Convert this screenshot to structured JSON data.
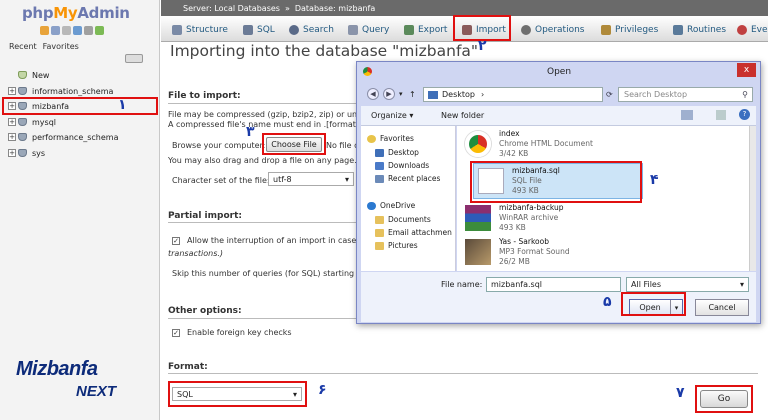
{
  "sidebar": {
    "logo_php": "php",
    "logo_my": "My",
    "logo_admin": "Admin",
    "recent_tab": "Recent",
    "favorites_tab": "Favorites",
    "tree": [
      {
        "label": "New",
        "expander": ""
      },
      {
        "label": "information_schema",
        "expander": "+"
      },
      {
        "label": "mizbanfa",
        "expander": "+"
      },
      {
        "label": "mysql",
        "expander": "+"
      },
      {
        "label": "performance_schema",
        "expander": "+"
      },
      {
        "label": "sys",
        "expander": "+"
      }
    ],
    "brand": "Mizbanfa",
    "brand_sub": "NEXT"
  },
  "breadcrumb": {
    "server": "Server: Local Databases",
    "separator": "»",
    "database": "Database: mizbanfa"
  },
  "tabs": [
    {
      "label": "Structure",
      "icon": "structure-icon",
      "color": "#7a8aa6"
    },
    {
      "label": "SQL",
      "icon": "sql-icon",
      "color": "#6b7b96"
    },
    {
      "label": "Search",
      "icon": "search-icon",
      "color": "#5a6a88"
    },
    {
      "label": "Query",
      "icon": "query-icon",
      "color": "#8a94aa"
    },
    {
      "label": "Export",
      "icon": "export-icon",
      "color": "#5b8a5b"
    },
    {
      "label": "Import",
      "icon": "import-icon",
      "color": "#8a5b5b"
    },
    {
      "label": "Operations",
      "icon": "operations-icon",
      "color": "#6f6f6f"
    },
    {
      "label": "Privileges",
      "icon": "privileges-icon",
      "color": "#b08a3a"
    },
    {
      "label": "Routines",
      "icon": "routines-icon",
      "color": "#5a7a9a"
    },
    {
      "label": "Eve",
      "icon": "events-icon",
      "color": "#c04040"
    }
  ],
  "main": {
    "title": "Importing into the database \"mizbanfa\"",
    "file_to_import": {
      "heading": "File to import:",
      "line1": "File may be compressed (gzip, bzip2, zip) or unco",
      "line2": "A compressed file's name must end in .[format].[",
      "browse_label": "Browse your computer:",
      "choose_file": "Choose File",
      "no_file": "No file c",
      "drag_drop": "You may also drag and drop a file on any page.",
      "charset_label": "Character set of the file:",
      "charset_value": "utf-8"
    },
    "partial_import": {
      "heading": "Partial import:",
      "allow_label": "Allow the interruption of an import in case th",
      "allow_label2": "transactions.)",
      "skip_label": "Skip this number of queries (for SQL) starting fro"
    },
    "other_options": {
      "heading": "Other options:",
      "fk_label": "Enable foreign key checks"
    },
    "format": {
      "heading": "Format:",
      "value": "SQL"
    },
    "go": "Go"
  },
  "dialog": {
    "title": "Open",
    "close": "x",
    "path": "Desktop",
    "search_placeholder": "Search Desktop",
    "organize": "Organize ▾",
    "new_folder": "New folder",
    "nav": {
      "favorites": "Favorites",
      "desktop": "Desktop",
      "downloads": "Downloads",
      "recent": "Recent places",
      "onedrive": "OneDrive",
      "documents": "Documents",
      "email": "Email attachmen",
      "pictures": "Pictures"
    },
    "files": [
      {
        "name": "index",
        "type": "Chrome HTML Document",
        "size": "3/42 KB",
        "icon": "chrome-icon"
      },
      {
        "name": "mizbanfa.sql",
        "type": "SQL File",
        "size": "493 KB",
        "icon": "sql-file-icon"
      },
      {
        "name": "mizbanfa-backup",
        "type": "WinRAR archive",
        "size": "493 KB",
        "icon": "winrar-icon"
      },
      {
        "name": "Yas - Sarkoob",
        "type": "MP3 Format Sound",
        "size": "26/2 MB",
        "icon": "music-icon"
      }
    ],
    "filename_label": "File name:",
    "filename_value": "mizbanfa.sql",
    "filetype_value": "All Files",
    "open": "Open",
    "cancel": "Cancel"
  },
  "annotations": [
    "۱",
    "۲",
    "۳",
    "۴",
    "۵",
    "۶",
    "۷"
  ]
}
